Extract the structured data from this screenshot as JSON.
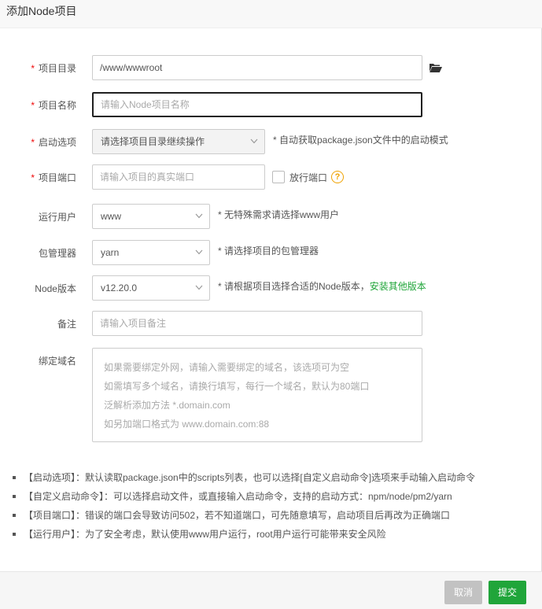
{
  "dialog": {
    "title": "添加Node项目"
  },
  "form": {
    "required_mark": "*",
    "project_dir": {
      "label": "项目目录",
      "value": "/www/wwwroot"
    },
    "project_name": {
      "label": "项目名称",
      "placeholder": "请输入Node项目名称"
    },
    "start_option": {
      "label": "启动选项",
      "selected": "请选择项目目录继续操作",
      "hint": "* 自动获取package.json文件中的启动模式"
    },
    "project_port": {
      "label": "项目端口",
      "placeholder": "请输入项目的真实端口",
      "checkbox_label": "放行端口",
      "help_icon": "?"
    },
    "run_user": {
      "label": "运行用户",
      "selected": "www",
      "hint": "* 无特殊需求请选择www用户"
    },
    "package_manager": {
      "label": "包管理器",
      "selected": "yarn",
      "hint": "* 请选择项目的包管理器"
    },
    "node_version": {
      "label": "Node版本",
      "selected": "v12.20.0",
      "hint": "* 请根据项目选择合适的Node版本，",
      "hint_link": "安装其他版本"
    },
    "remark": {
      "label": "备注",
      "placeholder": "请输入项目备注"
    },
    "bind_domain": {
      "label": "绑定域名",
      "placeholder_lines": [
        "如果需要绑定外网，请输入需要绑定的域名，该选项可为空",
        "如需填写多个域名，请换行填写，每行一个域名，默认为80端口",
        "泛解析添加方法 *.domain.com",
        "如另加端口格式为 www.domain.com:88"
      ]
    }
  },
  "tips": [
    "【启动选项】：默认读取package.json中的scripts列表，也可以选择[自定义启动命令]选项来手动输入启动命令",
    "【自定义启动命令】：可以选择启动文件，或直接输入启动命令，支持的启动方式：npm/node/pm2/yarn",
    "【项目端口】：错误的端口会导致访问502，若不知道端口，可先随意填写，启动项目后再改为正确端口",
    "【运行用户】：为了安全考虑，默认使用www用户运行，root用户运行可能带来安全风险"
  ],
  "footer": {
    "cancel_label": "取消",
    "submit_label": "提交"
  },
  "icons": {
    "folder": "folder-open-icon",
    "chevron": "chevron-down-icon",
    "help": "question-circle-icon"
  },
  "colors": {
    "accent": "#20a53a",
    "required": "#ef0808",
    "warning": "#f0a200",
    "disabled_button": "#c2c2c2"
  }
}
